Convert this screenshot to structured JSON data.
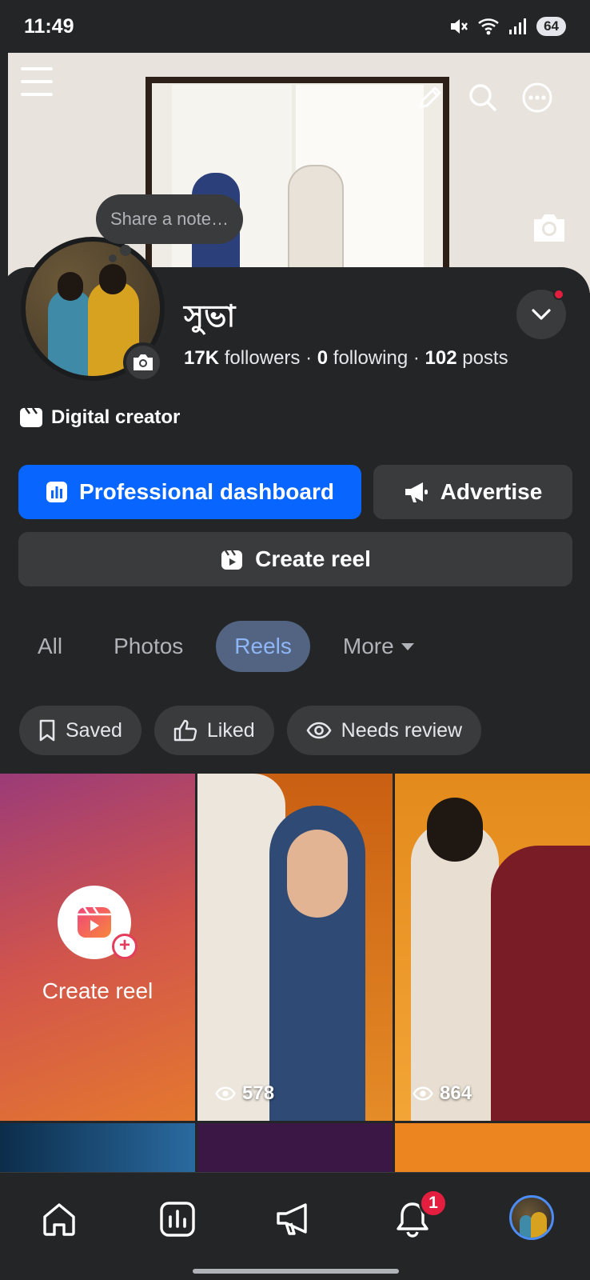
{
  "status_bar": {
    "time": "11:49",
    "battery": "64",
    "icons": [
      "mute-icon",
      "wifi-icon",
      "signal-icon",
      "battery-icon"
    ]
  },
  "cover": {
    "icons": [
      "menu-icon",
      "edit-pencil-icon",
      "search-icon",
      "more-icon",
      "camera-icon"
    ]
  },
  "note": {
    "placeholder": "Share a note…"
  },
  "profile": {
    "name": "সুভা",
    "followers_count": "17K",
    "followers_label": "followers",
    "following_count": "0",
    "following_label": "following",
    "posts_count": "102",
    "posts_label": "posts",
    "separator": "·",
    "category": "Digital creator"
  },
  "actions": {
    "dashboard_label": "Professional dashboard",
    "advertise_label": "Advertise",
    "create_reel_label": "Create reel"
  },
  "tabs": [
    {
      "label": "All",
      "active": false
    },
    {
      "label": "Photos",
      "active": false
    },
    {
      "label": "Reels",
      "active": true
    },
    {
      "label": "More",
      "active": false
    }
  ],
  "chips": [
    {
      "label": "Saved",
      "icon": "bookmark-icon"
    },
    {
      "label": "Liked",
      "icon": "thumbs-up-icon"
    },
    {
      "label": "Needs review",
      "icon": "eye-icon"
    }
  ],
  "grid": {
    "create_label": "Create reel",
    "reels": [
      {
        "views": "578"
      },
      {
        "views": "864"
      }
    ]
  },
  "bottom_nav": {
    "items": [
      "home-icon",
      "dashboard-icon",
      "megaphone-icon",
      "bell-icon",
      "profile-avatar"
    ],
    "notification_count": "1"
  },
  "colors": {
    "background": "#242526",
    "surface": "#3a3b3c",
    "primary": "#0866ff",
    "active_tab_bg": "#526482",
    "active_tab_text": "#8fb6f7",
    "badge": "#e41e3f"
  }
}
